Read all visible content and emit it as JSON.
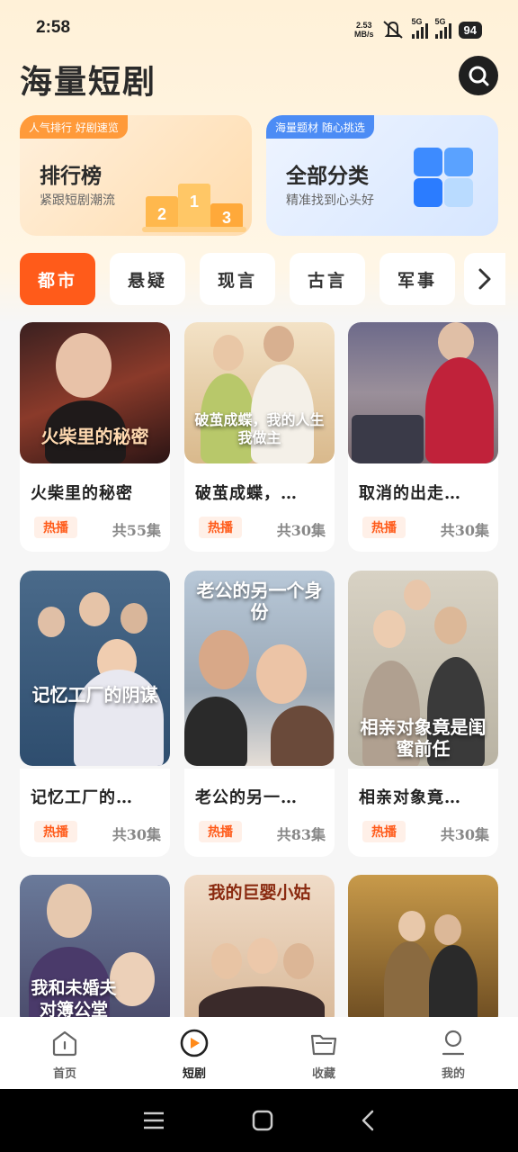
{
  "status_bar": {
    "time": "2:58",
    "net_speed_value": "2.53",
    "net_speed_unit": "MB/s",
    "signal_1": "5G",
    "signal_2": "5G",
    "battery": "94"
  },
  "header": {
    "title": "海量短剧"
  },
  "banners": [
    {
      "tag": "人气排行 好剧速览",
      "title": "排行榜",
      "subtitle": "紧跟短剧潮流",
      "podium": [
        "2",
        "1",
        "3"
      ]
    },
    {
      "tag": "海量题材 随心挑选",
      "title": "全部分类",
      "subtitle": "精准找到心头好"
    }
  ],
  "tabs": [
    {
      "label": "都市",
      "active": true
    },
    {
      "label": "悬疑",
      "active": false
    },
    {
      "label": "现言",
      "active": false
    },
    {
      "label": "古言",
      "active": false
    },
    {
      "label": "军事",
      "active": false
    }
  ],
  "dramas": [
    {
      "title": "火柴里的秘密",
      "poster_text": "火柴里的秘密",
      "badge": "热播",
      "episodes": "共55集"
    },
    {
      "title": "破茧成蝶，…",
      "poster_text": "破茧成蝶，我的人生我做主",
      "badge": "热播",
      "episodes": "共30集"
    },
    {
      "title": "取消的出走…",
      "poster_text": "",
      "badge": "热播",
      "episodes": "共30集"
    },
    {
      "title": "记忆工厂的…",
      "poster_text": "记忆工厂的阴谋",
      "badge": "热播",
      "episodes": "共30集"
    },
    {
      "title": "老公的另一…",
      "poster_text": "老公的另一个身份",
      "badge": "热播",
      "episodes": "共83集"
    },
    {
      "title": "相亲对象竟…",
      "poster_text": "相亲对象竟是闺蜜前任",
      "badge": "热播",
      "episodes": "共30集"
    },
    {
      "title": "",
      "poster_text": "我和未婚夫对簿公堂",
      "badge": "",
      "episodes": ""
    },
    {
      "title": "",
      "poster_text": "我的巨婴小姑",
      "badge": "",
      "episodes": ""
    },
    {
      "title": "",
      "poster_text": "",
      "badge": "",
      "episodes": ""
    }
  ],
  "bottom_nav": [
    {
      "label": "首页",
      "icon": "home-icon",
      "active": false
    },
    {
      "label": "短剧",
      "icon": "play-icon",
      "active": true
    },
    {
      "label": "收藏",
      "icon": "folder-icon",
      "active": false
    },
    {
      "label": "我的",
      "icon": "person-icon",
      "active": false
    }
  ],
  "colors": {
    "accent": "#ff5b1a",
    "rank_tag": "#ff9a3a",
    "category_tag": "#4c8cf5"
  }
}
